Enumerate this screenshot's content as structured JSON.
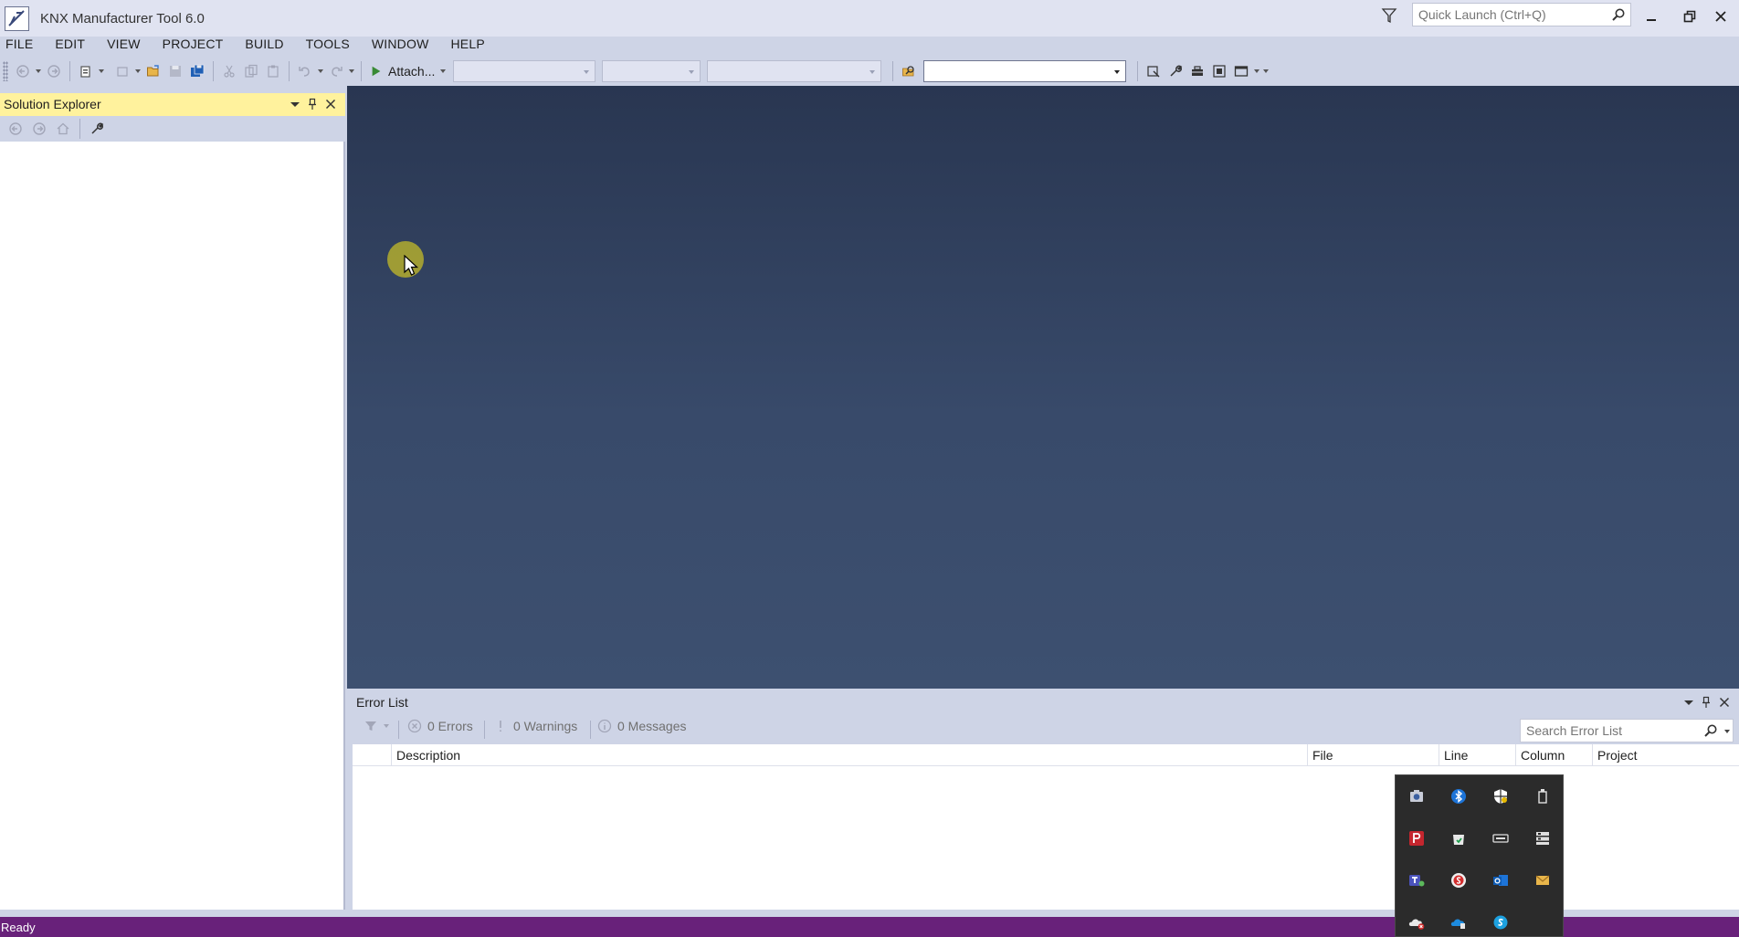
{
  "window": {
    "title": "KNX Manufacturer Tool 6.0",
    "quick_launch_placeholder": "Quick Launch (Ctrl+Q)"
  },
  "menu": {
    "items": [
      "FILE",
      "EDIT",
      "VIEW",
      "PROJECT",
      "BUILD",
      "TOOLS",
      "WINDOW",
      "HELP"
    ]
  },
  "toolbar": {
    "attach_label": "Attach...",
    "find_combo_value": ""
  },
  "solution_explorer": {
    "title": "Solution Explorer"
  },
  "error_list": {
    "title": "Error List",
    "errors_label": "0 Errors",
    "warnings_label": "0 Warnings",
    "messages_label": "0 Messages",
    "search_placeholder": "Search Error List",
    "columns": [
      "Description",
      "File",
      "Line",
      "Column",
      "Project"
    ]
  },
  "tray": {
    "icons": [
      "camera-icon",
      "bluetooth-icon",
      "security-shield-icon",
      "usb-drive-icon",
      "p-app-icon",
      "store-icon",
      "keyboard-icon",
      "task-manager-icon",
      "teams-icon",
      "s-app-icon",
      "outlook-icon",
      "mail-icon",
      "onedrive-error-icon",
      "onedrive-icon",
      "skype-icon"
    ]
  },
  "status": {
    "text": "Ready"
  },
  "colors": {
    "accent_status": "#68217a",
    "panel_header_active": "#fff29d",
    "chrome": "#ced4e6",
    "document_well": "#2f3d5a"
  }
}
